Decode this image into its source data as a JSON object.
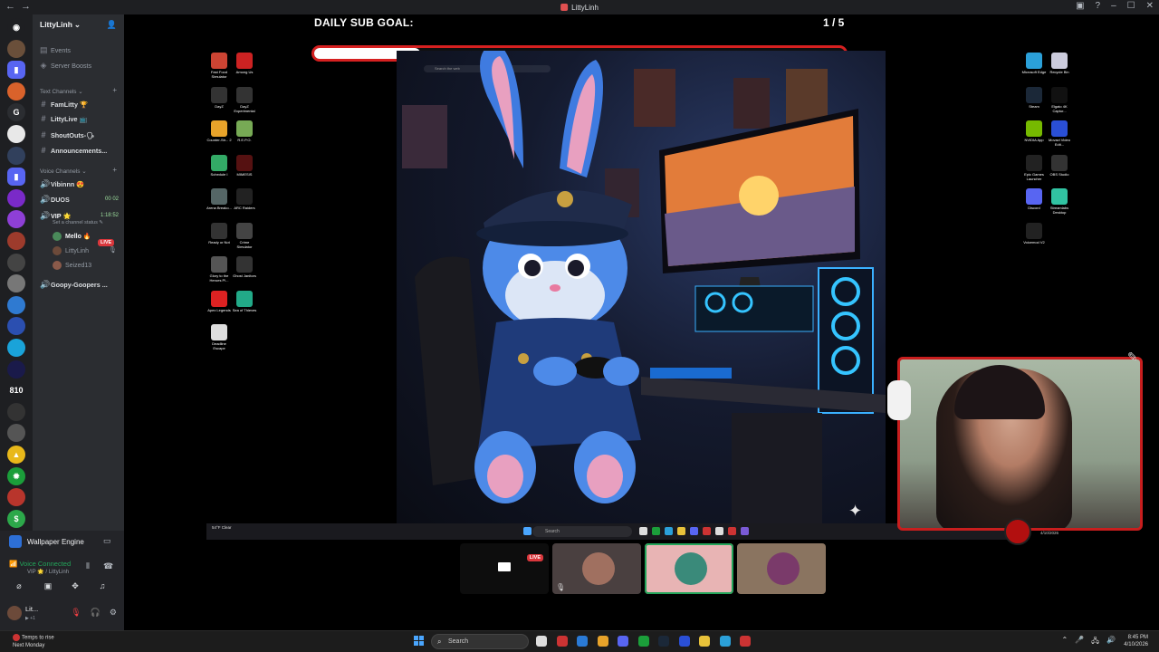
{
  "window": {
    "title": "LittyLinh",
    "nav": [
      "←",
      "→"
    ],
    "controls": [
      "▣",
      "?",
      "–",
      "☐",
      "✕"
    ]
  },
  "server_rail": {
    "icons": [
      {
        "name": "discord-home-icon",
        "glyph": "◉",
        "color": "#1e1f22"
      },
      {
        "name": "server-icon-1",
        "glyph": "",
        "color": "#6a4f3a"
      },
      {
        "name": "server-icon-2",
        "glyph": "▮",
        "color": "#5865f2"
      },
      {
        "name": "server-icon-3",
        "glyph": "",
        "color": "#d9622b"
      },
      {
        "name": "server-icon-4",
        "glyph": "G",
        "color": "#2b2d31"
      },
      {
        "name": "server-icon-5",
        "glyph": "",
        "color": "#e8e8e8"
      },
      {
        "name": "server-icon-6",
        "glyph": "",
        "color": "#31405c"
      },
      {
        "name": "server-icon-7",
        "glyph": "▮",
        "color": "#5865f2"
      },
      {
        "name": "server-icon-8",
        "glyph": "",
        "color": "#7a2ac8"
      },
      {
        "name": "server-icon-9",
        "glyph": "",
        "color": "#8e3fd6"
      },
      {
        "name": "server-icon-10",
        "glyph": "",
        "color": "#9d3b2c"
      },
      {
        "name": "server-icon-11",
        "glyph": "",
        "color": "#444"
      },
      {
        "name": "server-icon-12",
        "glyph": "",
        "color": "#777"
      },
      {
        "name": "server-icon-13",
        "glyph": "",
        "color": "#2f7ad1"
      },
      {
        "name": "server-icon-14",
        "glyph": "",
        "color": "#2b4fb0"
      },
      {
        "name": "server-icon-15",
        "glyph": "",
        "color": "#1aa3d9"
      },
      {
        "name": "server-icon-16",
        "glyph": "",
        "color": "#1a1a4a"
      },
      {
        "name": "server-icon-17",
        "glyph": "810",
        "color": "#1e1f22"
      },
      {
        "name": "server-icon-18",
        "glyph": "",
        "color": "#333"
      },
      {
        "name": "server-icon-19",
        "glyph": "",
        "color": "#555"
      },
      {
        "name": "server-icon-20",
        "glyph": "▲",
        "color": "#e8b81a"
      },
      {
        "name": "server-icon-21",
        "glyph": "✹",
        "color": "#1b9e3a"
      },
      {
        "name": "server-icon-22",
        "glyph": "",
        "color": "#b8352c"
      },
      {
        "name": "server-icon-23",
        "glyph": "$",
        "color": "#2ca84a"
      }
    ]
  },
  "sidebar": {
    "guild": "LittyLinh",
    "events": "Events",
    "boosts": "Server Boosts",
    "text_category": "Text Channels",
    "text_channels": [
      "FamLitty 🏆",
      "LittyLive 📺",
      "ShoutOuts-🗣",
      "Announcements..."
    ],
    "voice_category": "Voice Channels",
    "voice_channels": [
      {
        "name": "Vibinnn 😍",
        "extra": ""
      },
      {
        "name": "DUOS",
        "extra": "00  02"
      },
      {
        "name": "VIP 🌟",
        "extra": "1:18:52"
      }
    ],
    "channel_status": "Set a channel status ✎",
    "members": [
      {
        "name": "Mello 🔥",
        "live": "LIVE",
        "color": "#4a8a5a"
      },
      {
        "name": "LittyLinh",
        "live": "",
        "color": "#6c4a3a"
      },
      {
        "name": "Seized13",
        "live": "",
        "color": "#8a5a4a"
      }
    ],
    "bottom_channel": "Goopy-Goopers ..."
  },
  "userpanel": {
    "activity": "Wallpaper Engine",
    "voice_status": "Voice Connected",
    "voice_sub": "VIP 🌟 / LittyLinh",
    "username": "Lit...",
    "user_sub": "▶ +1"
  },
  "stream": {
    "goal_label": "DAILY SUB GOAL:",
    "goal_count": "1 / 5",
    "goal_progress": 0.2,
    "wallpaper_search": "Search the web",
    "left_icons": [
      {
        "label": "Fast Food Simulator",
        "color": "#c43"
      },
      {
        "label": "Among Us",
        "color": "#c22"
      },
      {
        "label": "DayZ",
        "color": "#333"
      },
      {
        "label": "DayZ Experimental",
        "color": "#333"
      },
      {
        "label": "Counter-Str... 2",
        "color": "#e8a32a"
      },
      {
        "label": "R.E.P.O.",
        "color": "#7a5"
      },
      {
        "label": "Schedule I",
        "color": "#3a6"
      },
      {
        "label": "MIMESIS",
        "color": "#511"
      },
      {
        "label": "Arena Breako...",
        "color": "#566"
      },
      {
        "label": "ARC Raiders",
        "color": "#222"
      },
      {
        "label": "Ready or Not",
        "color": "#333"
      },
      {
        "label": "Crime Simulator",
        "color": "#444"
      },
      {
        "label": "Glory to the Heroes Pl...",
        "color": "#555"
      },
      {
        "label": "Ghost Janitors",
        "color": "#333"
      },
      {
        "label": "Apex Legends",
        "color": "#d22"
      },
      {
        "label": "Sea of Thieves",
        "color": "#2a8"
      },
      {
        "label": "Deadline Escape",
        "color": "#ddd"
      }
    ],
    "right_icons": [
      {
        "label": "Microsoft Edge",
        "color": "#2ba0d9"
      },
      {
        "label": "Recycle Bin",
        "color": "#ccd"
      },
      {
        "label": "Steam",
        "color": "#1b2838"
      },
      {
        "label": "Elgato 4K Captur...",
        "color": "#111"
      },
      {
        "label": "NVIDIA App",
        "color": "#76b900"
      },
      {
        "label": "Movavi Video Edit...",
        "color": "#2a4fd6"
      },
      {
        "label": "Epic Games Launcher",
        "color": "#222"
      },
      {
        "label": "OBS Studio",
        "color": "#333"
      },
      {
        "label": "Discord",
        "color": "#5865f2"
      },
      {
        "label": "Streamlabs Desktop",
        "color": "#31c3a2"
      },
      {
        "label": "Voicemod V2",
        "color": "#222"
      }
    ],
    "inner_taskbar_search": "Search",
    "inner_weather": "54°F Clear",
    "cam_clock": "4/10/2026",
    "tiles": [
      {
        "name": "stream-tile",
        "live": "LIVE",
        "bg": "#0d0d0d",
        "avatar": ""
      },
      {
        "name": "littylinh-tile",
        "live": "",
        "bg": "#4a4040",
        "avatar": "#a07060"
      },
      {
        "name": "speaking-tile",
        "live": "",
        "bg": "#e8b4b4",
        "avatar": "#3a8a7a"
      },
      {
        "name": "seized-tile",
        "live": "",
        "bg": "#8a7460",
        "avatar": "#7a3a6a"
      }
    ]
  },
  "taskbar": {
    "weather_line1": "Temps to rise",
    "weather_line2": "Next Monday",
    "search": "Search",
    "time": "8:45 PM",
    "date": "4/10/2026",
    "tray": [
      "⌃",
      "🎤",
      "🖧",
      "🔊"
    ],
    "apps": [
      {
        "name": "task-view-icon",
        "color": "#ddd"
      },
      {
        "name": "app-red-icon",
        "color": "#c33"
      },
      {
        "name": "photos-icon",
        "color": "#2a7ad6"
      },
      {
        "name": "chrome-icon",
        "color": "#e8a32a"
      },
      {
        "name": "discord-taskbar-icon",
        "color": "#5865f2"
      },
      {
        "name": "xbox-icon",
        "color": "#1b9e3a"
      },
      {
        "name": "steam-taskbar-icon",
        "color": "#1b2838"
      },
      {
        "name": "app-blue-icon",
        "color": "#2a4fd6"
      },
      {
        "name": "file-explorer-icon",
        "color": "#e8c23a"
      },
      {
        "name": "edge-taskbar-icon",
        "color": "#2ba0d9"
      },
      {
        "name": "obs-taskbar-icon",
        "color": "#c33"
      }
    ]
  }
}
